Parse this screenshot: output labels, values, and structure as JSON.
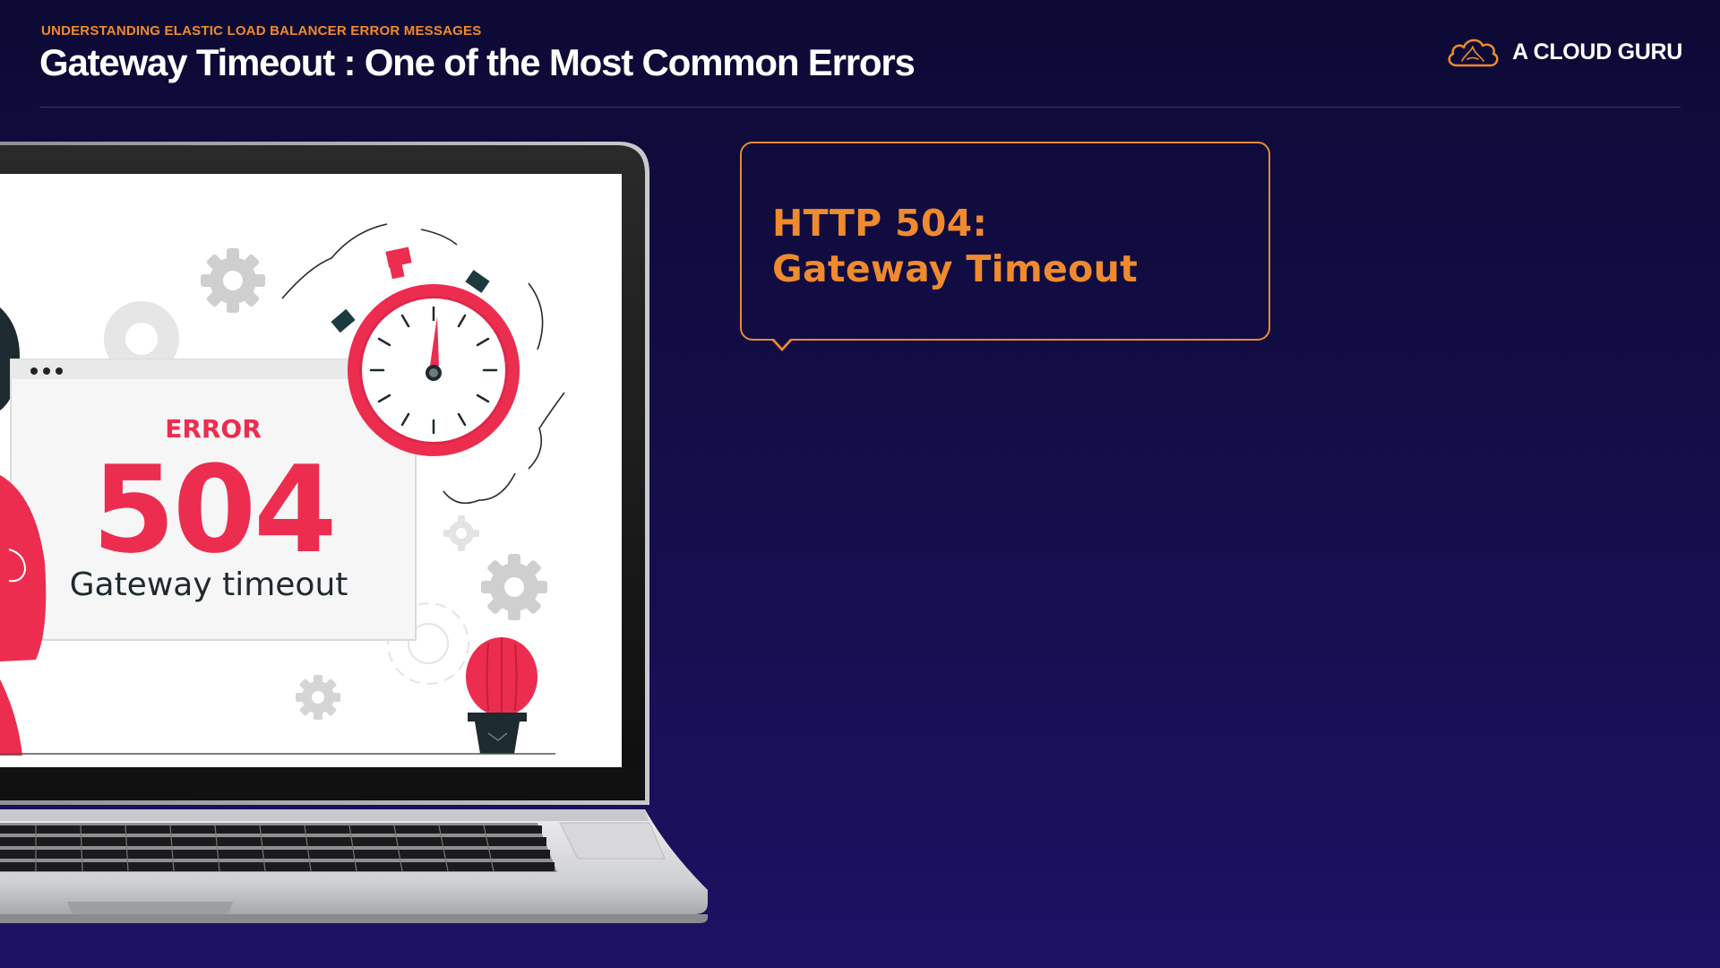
{
  "header": {
    "eyebrow": "UNDERSTANDING ELASTIC LOAD BALANCER ERROR MESSAGES",
    "title": "Gateway Timeout : One of the Most Common Errors"
  },
  "brand": {
    "name": "A CLOUD GURU",
    "logo_icon": "cloud-logo-icon"
  },
  "illustration": {
    "error_label": "ERROR",
    "error_code": "504",
    "error_caption": "Gateway timeout"
  },
  "callout": {
    "line1": "HTTP 504:",
    "line2": "Gateway Timeout"
  },
  "colors": {
    "background": "#150e4c",
    "accent_orange": "#ef8a2e",
    "error_red": "#ec2d4f",
    "white": "#ffffff"
  }
}
